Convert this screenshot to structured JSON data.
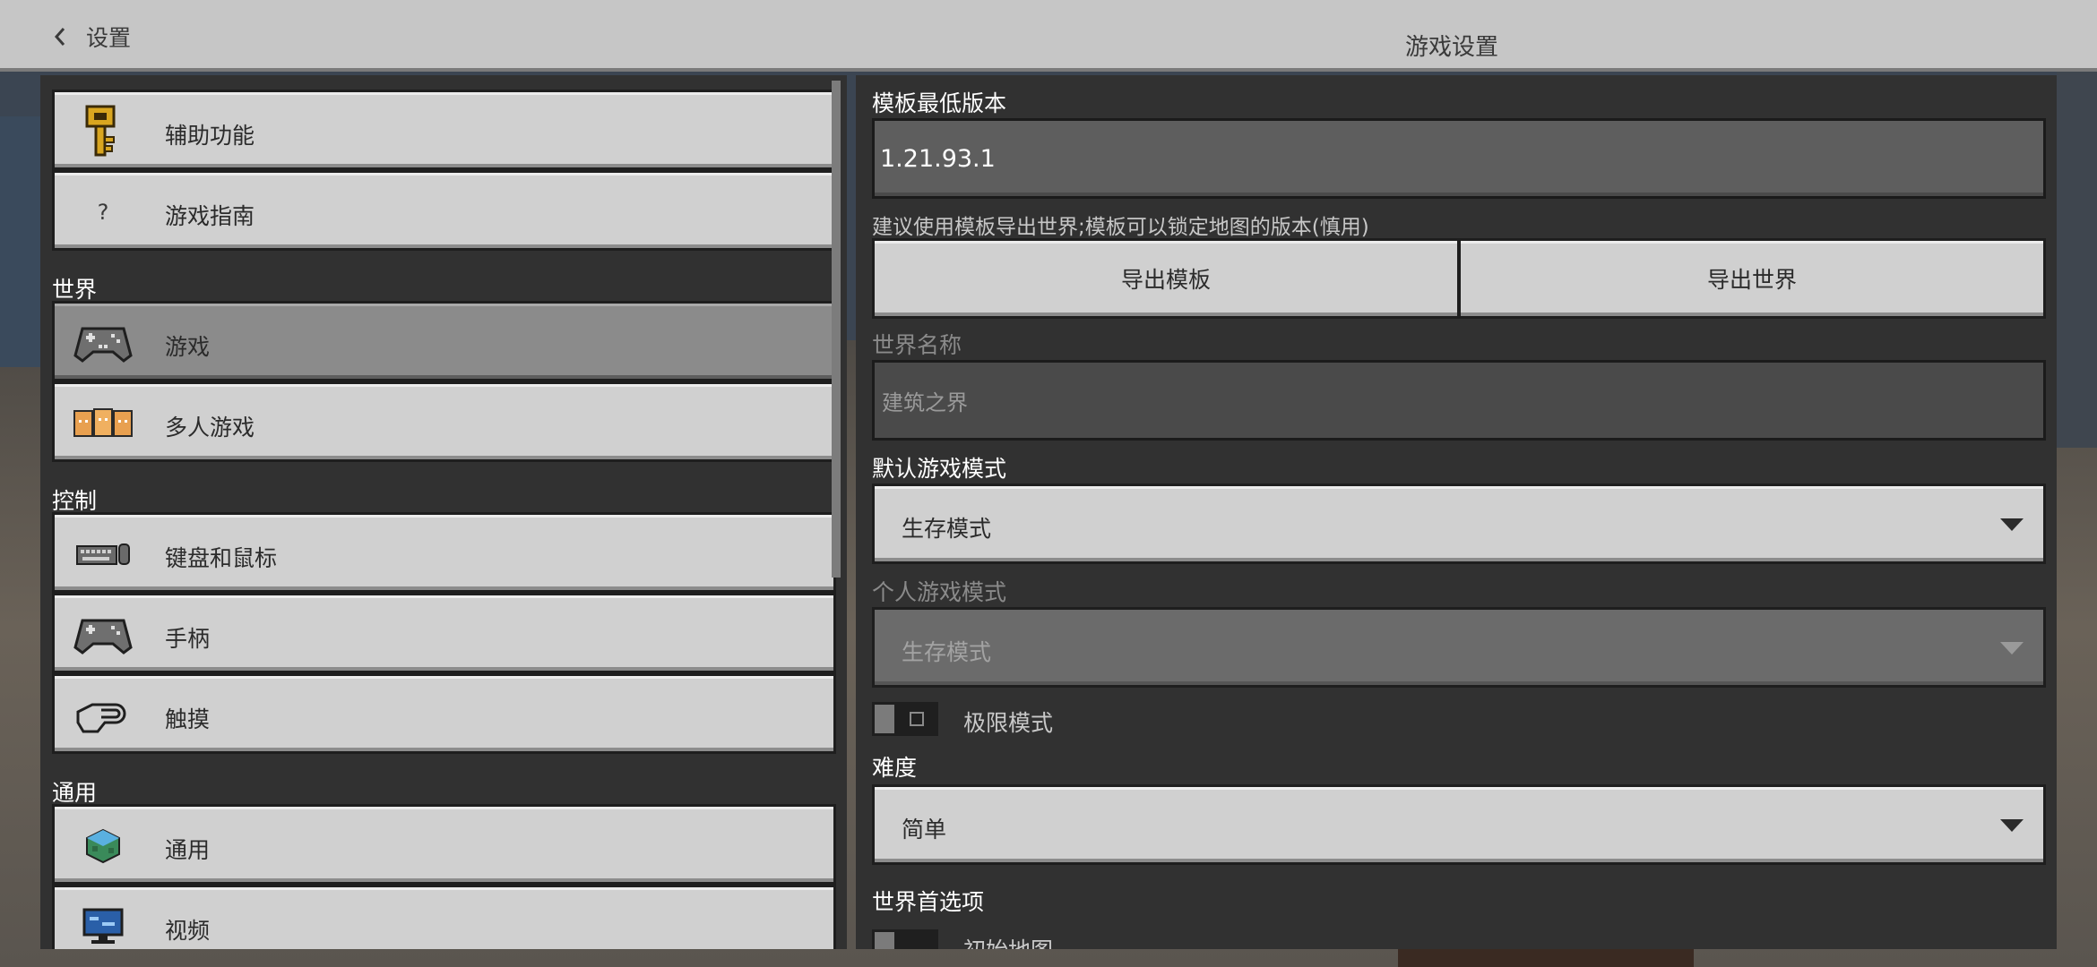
{
  "header": {
    "back_label": "设置",
    "title": "游戏设置"
  },
  "sidebar": {
    "items_top": [
      {
        "label": "辅助功能",
        "icon": "key-icon"
      },
      {
        "label": "游戏指南",
        "icon": "question-icon"
      }
    ],
    "sections": [
      {
        "title": "世界",
        "items": [
          {
            "label": "游戏",
            "icon": "controller-icon",
            "active": true
          },
          {
            "label": "多人游戏",
            "icon": "players-icon"
          }
        ]
      },
      {
        "title": "控制",
        "items": [
          {
            "label": "键盘和鼠标",
            "icon": "keyboard-mouse-icon"
          },
          {
            "label": "手柄",
            "icon": "gamepad-icon"
          },
          {
            "label": "触摸",
            "icon": "touch-hand-icon"
          }
        ]
      },
      {
        "title": "通用",
        "items": [
          {
            "label": "通用",
            "icon": "globe-cube-icon"
          },
          {
            "label": "视频",
            "icon": "monitor-icon"
          }
        ]
      }
    ]
  },
  "settings": {
    "template_min_version": {
      "label": "模板最低版本",
      "value": "1.21.93.1"
    },
    "export_hint": "建议使用模板导出世界;模板可以锁定地图的版本(慎用)",
    "export_template_label": "导出模板",
    "export_world_label": "导出世界",
    "world_name": {
      "label": "世界名称",
      "value": "建筑之界"
    },
    "default_game_mode": {
      "label": "默认游戏模式",
      "value": "生存模式"
    },
    "personal_game_mode": {
      "label": "个人游戏模式",
      "value": "生存模式"
    },
    "hardcore": {
      "label": "极限模式",
      "on": false
    },
    "difficulty": {
      "label": "难度",
      "value": "简单"
    },
    "world_prefs": {
      "label": "世界首选项",
      "starting_map_label": "初始地图"
    }
  },
  "colors": {
    "panel_bg": "#313131",
    "button_bg": "#d0d0d0",
    "active_bg": "#8b8b8b",
    "topbar_bg": "#c6c6c6"
  }
}
